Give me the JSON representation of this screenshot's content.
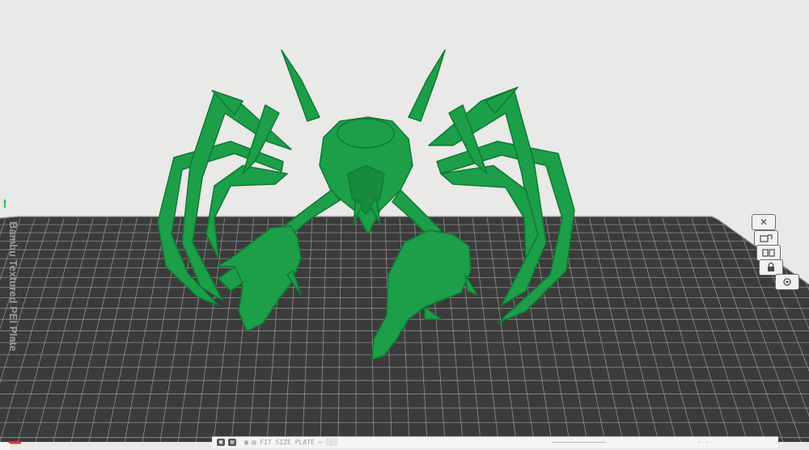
{
  "app": {
    "bed_label": "Bambu Textured PEI Plate"
  },
  "colors": {
    "background": "#e9e9e8",
    "plate": "#3b3b3b",
    "grid": "#8e8e8e",
    "model": "#1d9e48",
    "model_dark": "#0f7a33",
    "axis_x": "#e53935",
    "axis_y": "#2fbf4a"
  },
  "plate_tools": [
    {
      "name": "close-plate-icon",
      "glyph": "✕"
    },
    {
      "name": "auto-orient-icon",
      "glyph": ""
    },
    {
      "name": "arrange-icon",
      "glyph": ""
    },
    {
      "name": "lock-plate-icon",
      "glyph": ""
    },
    {
      "name": "plate-settings-icon",
      "glyph": ""
    }
  ],
  "status_bar": {
    "left": "▣ ▤  FIT SIZE PLATE  ─  ░░░",
    "middle": "──────────────",
    "right": "· ·"
  }
}
